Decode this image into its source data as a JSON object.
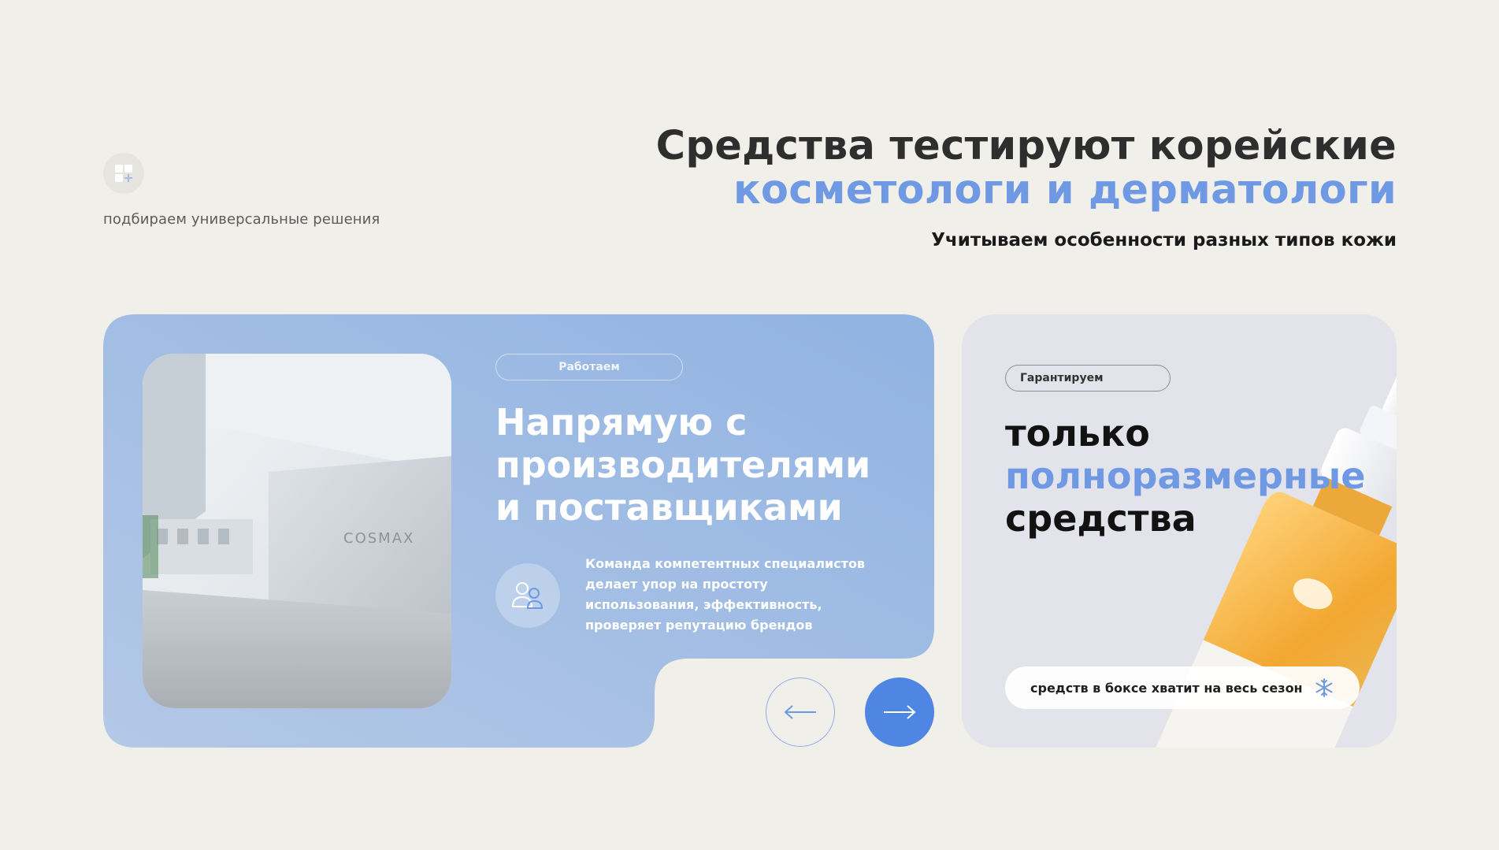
{
  "intro": {
    "icon": "grid-plus-icon",
    "caption": "подбираем универсальные решения"
  },
  "headline": {
    "line1": "Средства тестируют корейские",
    "line2": "косметологи и дерматологи",
    "subtitle": "Учитываем особенности разных типов кожи"
  },
  "card_left": {
    "chip": "Работаем",
    "title_lines": [
      "Напрямую с",
      "производителями",
      "и поставщиками"
    ],
    "description": "Команда компетентных специалистов делает упор на простоту использования, эффективность, проверяет репутацию брендов",
    "photo_sign": "COSMAX",
    "icon": "team-icon",
    "colors": {
      "gradient_start": "#b3c8e6",
      "gradient_end": "#8fb2e2"
    }
  },
  "navigation": {
    "prev_icon": "arrow-left-icon",
    "next_icon": "arrow-right-icon",
    "next_color": "#4f86e3"
  },
  "card_right": {
    "chip": "Гарантируем",
    "title_lines": [
      "только",
      "полноразмерные",
      "средства"
    ],
    "pill_text": "средств в боксе хватит на весь сезон",
    "pill_icon": "snowflake-icon",
    "accent": "#6f9ae3"
  }
}
